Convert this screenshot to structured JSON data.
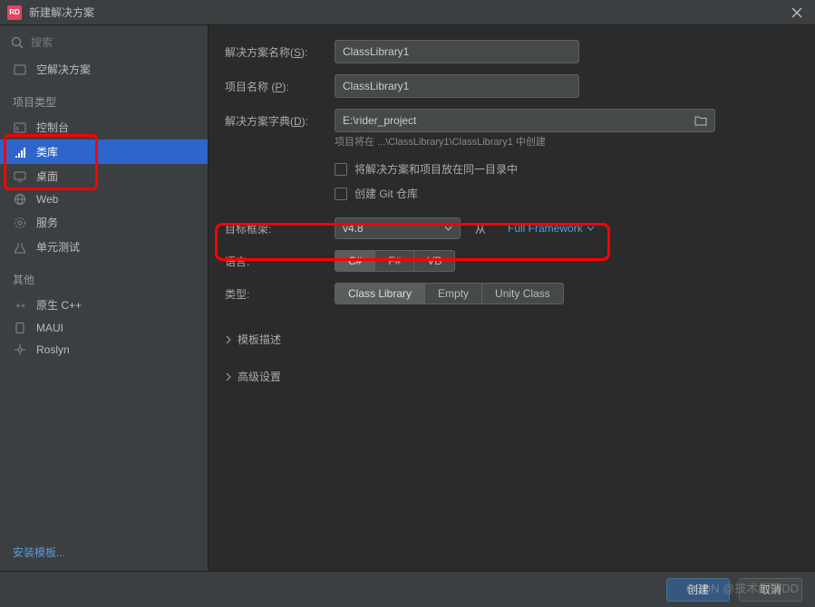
{
  "window": {
    "title": "新建解决方案"
  },
  "search": {
    "placeholder": "搜索"
  },
  "sidebar": {
    "empty_solution": "空解决方案",
    "section_project_types": "项目类型",
    "items": [
      {
        "label": "控制台"
      },
      {
        "label": "类库"
      },
      {
        "label": "桌面"
      },
      {
        "label": "Web"
      },
      {
        "label": "服务"
      },
      {
        "label": "单元测试"
      }
    ],
    "section_other": "其他",
    "other_items": [
      {
        "label": "原生 C++"
      },
      {
        "label": "MAUI"
      },
      {
        "label": "Roslyn"
      }
    ],
    "install_templates": "安装模板..."
  },
  "form": {
    "solution_name_label": "解决方案名称(S):",
    "solution_name": "ClassLibrary1",
    "project_name_label": "项目名称 (P):",
    "project_name": "ClassLibrary1",
    "dictionary_label": "解决方案字典(D):",
    "dictionary_path": "E:\\rider_project",
    "path_hint": "项目将在 ...\\ClassLibrary1\\ClassLibrary1 中创建",
    "same_dir_label": "将解决方案和项目放在同一目录中",
    "create_git_label": "创建 Git 仓库",
    "target_fw_label": "目标框架:",
    "target_fw_value": "v4.8",
    "fw_from": "从",
    "fw_link": "Full Framework",
    "language_label": "语言:",
    "languages": [
      "C#",
      "F#",
      "VB"
    ],
    "type_label": "类型:",
    "types": [
      "Class Library",
      "Empty",
      "Unity Class"
    ],
    "expander_template_desc": "模板描述",
    "expander_advanced": "高级设置"
  },
  "footer": {
    "create": "创建",
    "cancel": "取消"
  },
  "watermark": "CSDN @技术闲聊DD"
}
